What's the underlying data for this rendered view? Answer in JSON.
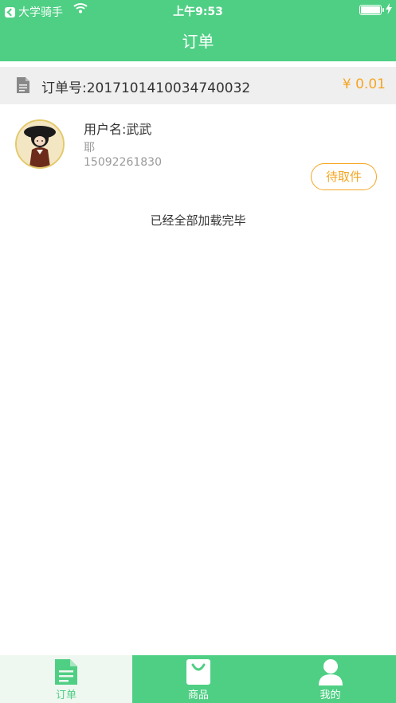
{
  "status_bar": {
    "back_app": "大学骑手",
    "time": "上午9:53"
  },
  "header": {
    "title": "订单"
  },
  "order": {
    "number_label": "订单号:2017101410034740032",
    "price": "¥ 0.01"
  },
  "user": {
    "name_label": "用户名:武武",
    "sub_text": "耶",
    "phone": "15092261830",
    "status_button": "待取件"
  },
  "list_footer": "已经全部加载完毕",
  "tabbar": {
    "items": [
      {
        "label": "订单",
        "icon": "document-icon",
        "active": true
      },
      {
        "label": "商品",
        "icon": "shopping-bag-icon",
        "active": false
      },
      {
        "label": "我的",
        "icon": "person-icon",
        "active": false
      }
    ]
  },
  "colors": {
    "brand_green": "#4fcf84",
    "accent_orange": "#f5a623",
    "order_bar_bg": "#efefef"
  }
}
